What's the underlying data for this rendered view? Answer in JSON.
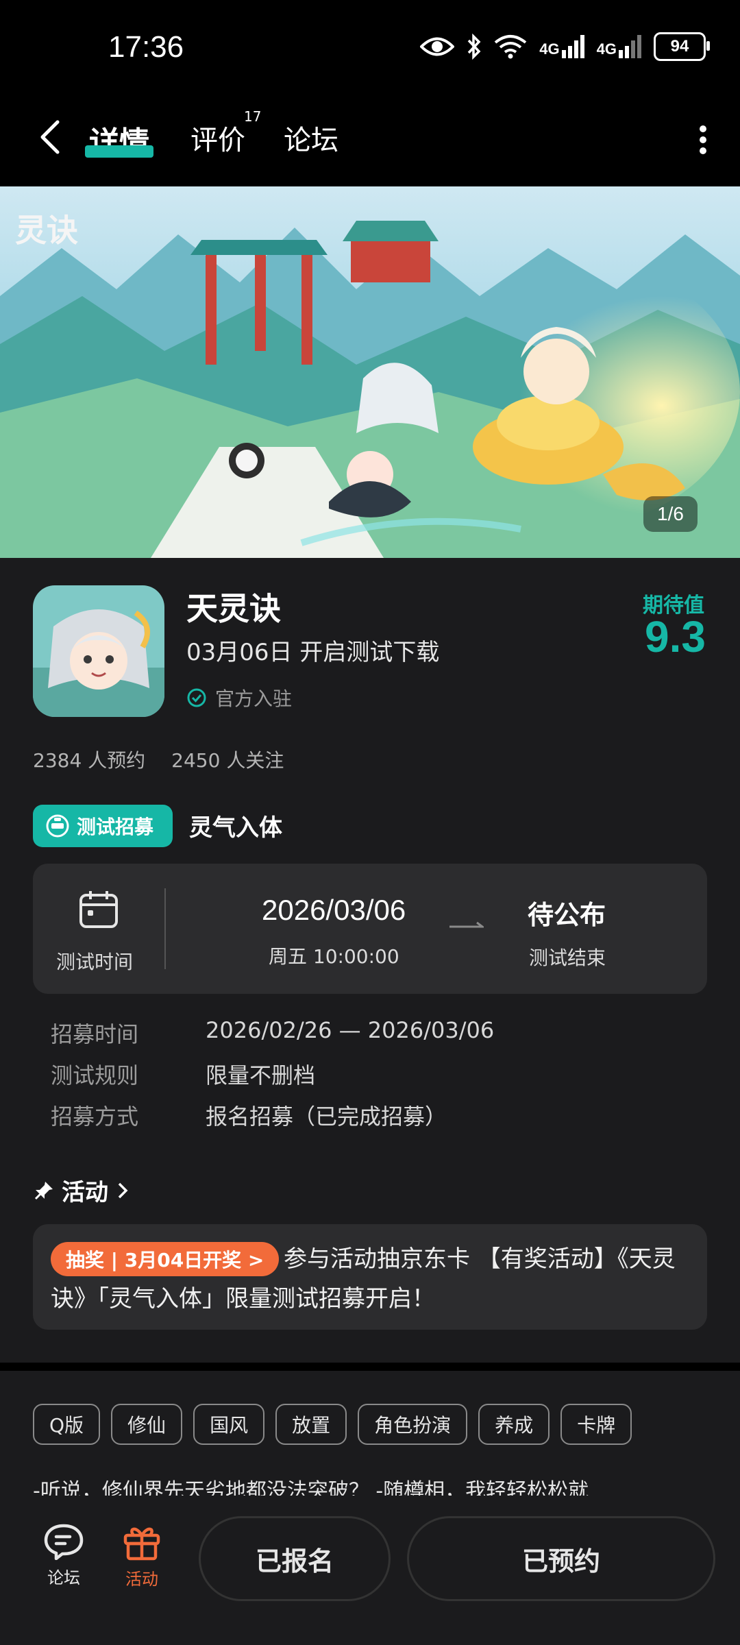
{
  "status_bar": {
    "time": "17:36",
    "network_1": "4G",
    "network_2": "4G",
    "battery": "94"
  },
  "nav": {
    "tabs": [
      {
        "label": "详情",
        "active": true
      },
      {
        "label": "评价",
        "badge": "17"
      },
      {
        "label": "论坛"
      }
    ]
  },
  "banner": {
    "counter": "1/6",
    "watermark": "灵诀"
  },
  "game": {
    "name": "天灵诀",
    "subtitle": "03月06日 开启测试下载",
    "official": "官方入驻",
    "rating_label": "期待值",
    "rating_value": "9.3",
    "reservations": "2384 人预约",
    "followers": "2450 人关注"
  },
  "test": {
    "badge_label": "测试招募",
    "test_name": "灵气入体",
    "time_label": "测试时间",
    "start_date": "2026/03/06",
    "start_time": "周五  10:00:00",
    "end_title": "待公布",
    "end_sub": "测试结束",
    "details": [
      {
        "label": "招募时间",
        "value": "2026/02/26 — 2026/03/06"
      },
      {
        "label": "测试规则",
        "value": "限量不删档"
      },
      {
        "label": "招募方式",
        "value": "报名招募（已完成招募）"
      }
    ]
  },
  "activity": {
    "heading": "活动",
    "tag": "抽奖 | 3月04日开奖 >",
    "text": "参与活动抽京东卡 【有奖活动】《天灵诀》「灵气入体」限量测试招募开启！"
  },
  "tags": [
    "Q版",
    "修仙",
    "国风",
    "放置",
    "角色扮演",
    "养成",
    "卡牌"
  ],
  "description": "-听说，修仙界先天劣地都没法突破？ -随樽相，我轻轻松松就",
  "bottom": {
    "forum_label": "论坛",
    "activity_label": "活动",
    "registered_button": "已报名",
    "reserved_button": "已预约"
  },
  "colors": {
    "accent": "#16b7a6",
    "orange": "#f26b3a",
    "background": "#1b1b1d"
  }
}
